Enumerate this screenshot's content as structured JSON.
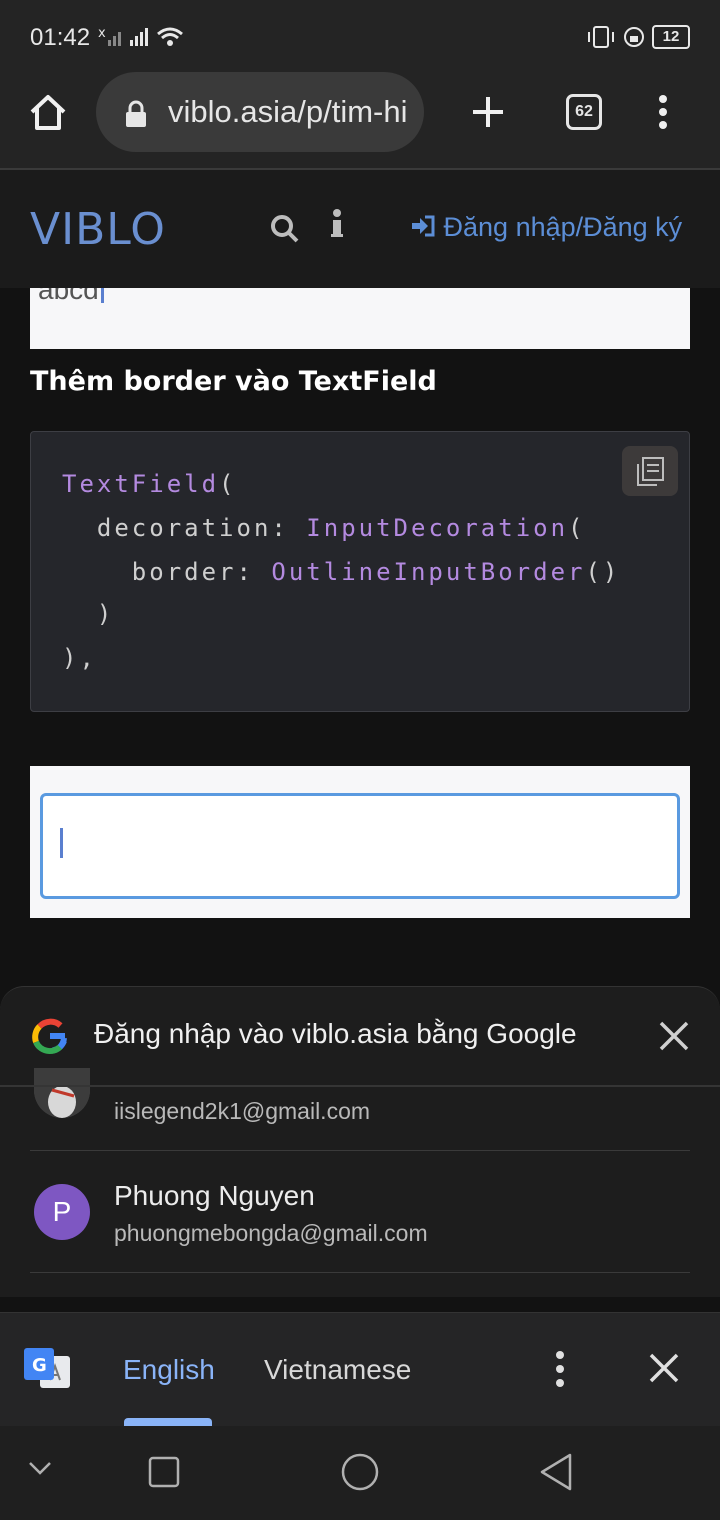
{
  "status_bar": {
    "time": "01:42",
    "battery": "12"
  },
  "browser": {
    "url": "viblo.asia/p/tim-hieu",
    "tab_count": "62"
  },
  "site": {
    "logo": "VIBLO",
    "login_label": "Đăng nhập/Đăng ký"
  },
  "content": {
    "panel1_text": "abcd",
    "section_heading": "Thêm border vào TextField",
    "code": {
      "line1_kw": "TextField",
      "line1_rest": "(",
      "line2_pre": "  decoration: ",
      "line2_kw": "InputDecoration",
      "line2_rest": "(",
      "line3_pre": "    border: ",
      "line3_kw": "OutlineInputBorder",
      "line3_rest": "()",
      "line4": "  )",
      "line5": "),"
    }
  },
  "google_sheet": {
    "title": "Đăng nhập vào viblo.asia bằng Google",
    "accounts": [
      {
        "name": "",
        "email": "iislegend2k1@gmail.com"
      },
      {
        "name": "Phuong Nguyen",
        "email": "phuongmebongda@gmail.com",
        "initial": "P"
      }
    ]
  },
  "translate_bar": {
    "source_lang": "English",
    "target_lang": "Vietnamese"
  },
  "colors": {
    "accent_blue": "#5c8ed6",
    "code_keyword": "#b48ae0",
    "avatar_purple": "#7e57c2",
    "translate_active": "#8ab4f8"
  }
}
